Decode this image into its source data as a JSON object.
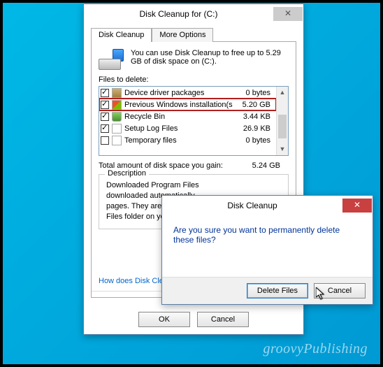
{
  "main": {
    "title": "Disk Cleanup for  (C:)",
    "tabs": [
      "Disk Cleanup",
      "More Options"
    ],
    "intro": "You can use Disk Cleanup to free up to 5.29 GB of disk space on  (C:).",
    "files_label": "Files to delete:",
    "rows": [
      {
        "checked": true,
        "icon": "pkg",
        "name": "Device driver packages",
        "size": "0 bytes",
        "hl": false
      },
      {
        "checked": true,
        "icon": "win",
        "name": "Previous Windows installation(s)",
        "size": "5.20 GB",
        "hl": true
      },
      {
        "checked": true,
        "icon": "bin",
        "name": "Recycle Bin",
        "size": "3.44 KB",
        "hl": false
      },
      {
        "checked": true,
        "icon": "file",
        "name": "Setup Log Files",
        "size": "26.9 KB",
        "hl": false
      },
      {
        "checked": false,
        "icon": "file",
        "name": "Temporary files",
        "size": "0 bytes",
        "hl": false
      }
    ],
    "total_label": "Total amount of disk space you gain:",
    "total_value": "5.24 GB",
    "group_title": "Description",
    "description": "Downloaded Program Files\ndownloaded automatically\npages. They are temporari\nFiles folder on your hard di",
    "link": "How does Disk Cleanup wor",
    "ok": "OK",
    "cancel": "Cancel"
  },
  "dialog": {
    "title": "Disk Cleanup",
    "message": "Are you sure you want to permanently delete these files?",
    "delete": "Delete Files",
    "cancel": "Cancel"
  },
  "watermark": "groovyPublishing"
}
